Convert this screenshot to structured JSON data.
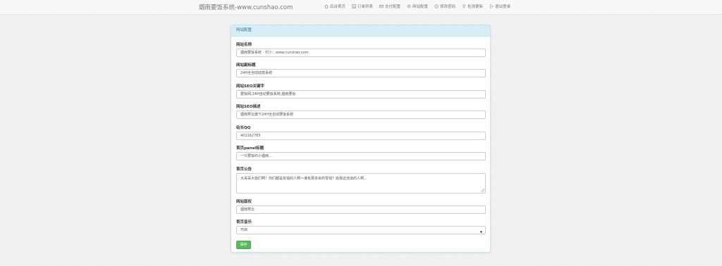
{
  "header": {
    "brand": "烟雨要饭系统-www.cunshao.com",
    "nav": [
      {
        "label": "后台首页",
        "icon": "home-icon"
      },
      {
        "label": "订单列表",
        "icon": "list-icon"
      },
      {
        "label": "支付配置",
        "icon": "card-icon"
      },
      {
        "label": "网站配置",
        "icon": "gear-icon"
      },
      {
        "label": "修改密码",
        "icon": "key-icon"
      },
      {
        "label": "检测更新",
        "icon": "pin-icon"
      },
      {
        "label": "退出登录",
        "icon": "logout-icon"
      }
    ]
  },
  "panel": {
    "title": "网站配置",
    "fields": [
      {
        "label": "网站名称",
        "value": "烟雨要饭系统 - 村少：www.cunshao.com"
      },
      {
        "label": "网站副标题",
        "value": "24H全自动收款系统"
      },
      {
        "label": "网站SEO关键字",
        "value": "要饭网,24H自动要饭系统,烟雨要饭"
      },
      {
        "label": "网站SEO描述",
        "value": "烟雨寒云旗下24H全自动要饭系统"
      },
      {
        "label": "站长QQ",
        "value": "401162765"
      },
      {
        "label": "首页panel标题",
        "value": "一只要饭的小烟雨..."
      },
      {
        "label": "首页公告",
        "value": "大哥哥大姐们啊！你们都是有钱的人啊～谁有那多余的零钱？给我这流浪的人啊..."
      },
      {
        "label": "网站版权",
        "value": "烟雨寒云"
      },
      {
        "label": "首页音乐",
        "value": "开启"
      }
    ],
    "save_label": "保存"
  }
}
